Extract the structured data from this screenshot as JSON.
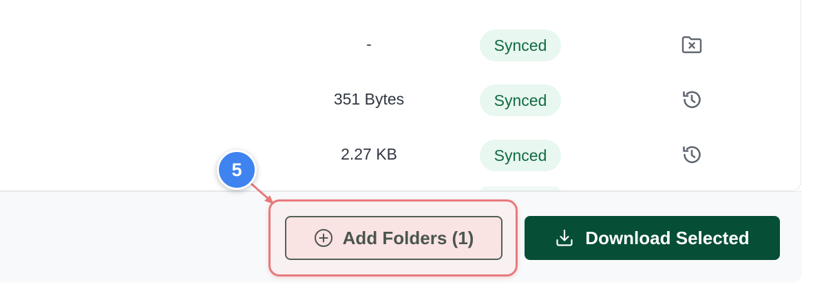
{
  "files_table": {
    "rows": [
      {
        "size": "-",
        "status": "Synced",
        "action_icon": "folder-x-icon"
      },
      {
        "size": "351 Bytes",
        "status": "Synced",
        "action_icon": "history-icon"
      },
      {
        "size": "2.27 KB",
        "status": "Synced",
        "action_icon": "history-icon"
      }
    ]
  },
  "footer": {
    "add_folders_label": "Add Folders (1)",
    "download_label": "Download Selected"
  },
  "annotation": {
    "step_number": "5",
    "marker_color": "#3f83f0",
    "highlight_color": "#e8787b"
  },
  "colors": {
    "synced_badge_bg": "#e8f7ef",
    "synced_badge_text": "#116b43",
    "primary_button_bg": "#064e36"
  }
}
